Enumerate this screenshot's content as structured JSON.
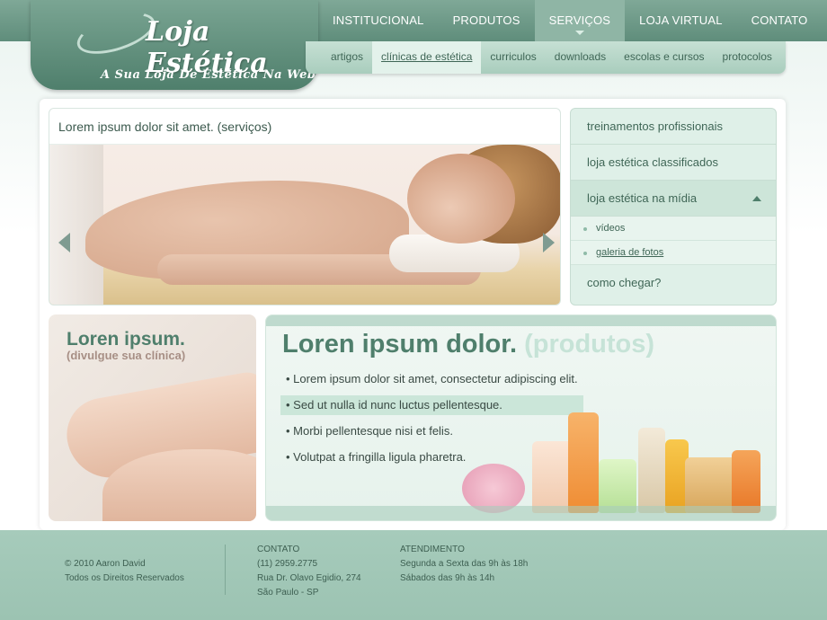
{
  "logo": {
    "title": "Loja Estética",
    "subtitle": "A Sua Loja De Estética Na Web"
  },
  "nav": {
    "items": [
      "INSTITUCIONAL",
      "PRODUTOS",
      "SERVIÇOS",
      "LOJA VIRTUAL",
      "CONTATO"
    ],
    "active": "SERVIÇOS"
  },
  "subnav": {
    "items": [
      "artigos",
      "clínicas de estética",
      "curriculos",
      "downloads",
      "escolas e cursos",
      "protocolos"
    ],
    "active": "clínicas de estética"
  },
  "hero": {
    "title": "Lorem ipsum dolor sit amet. (serviços)"
  },
  "sidebar": {
    "items": [
      {
        "label": "treinamentos profissionais"
      },
      {
        "label": "loja estética classificados"
      },
      {
        "label": "loja estética na mídia",
        "expanded": true,
        "children": [
          "vídeos",
          "galeria de fotos"
        ]
      },
      {
        "label": "como chegar?"
      }
    ]
  },
  "card": {
    "title": "Loren ipsum.",
    "subtitle": "(divulgue sua clínica)"
  },
  "promo": {
    "title": "Loren ipsum dolor.",
    "title_light": "(produtos)",
    "bullets": [
      "Lorem ipsum dolor sit amet, consectetur adipiscing elit.",
      "Sed ut nulla id nunc luctus pellentesque.",
      "Morbi pellentesque nisi et felis.",
      "Volutpat a fringilla ligula pharetra."
    ],
    "highlighted_index": 1
  },
  "footer": {
    "copyright": [
      "© 2010 Aaron David",
      "Todos os Direitos Reservados"
    ],
    "contato": {
      "heading": "CONTATO",
      "lines": [
        "(11) 2959.2775",
        "Rua Dr. Olavo Egidio, 274",
        "São Paulo - SP"
      ]
    },
    "atendimento": {
      "heading": "ATENDIMENTO",
      "lines": [
        "Segunda a Sexta das 9h às 18h",
        "Sábados das 9h às 14h"
      ]
    }
  },
  "colors": {
    "brand": "#5f8d7b",
    "accent_light": "#dff0e8",
    "footer": "#a6cbbb"
  }
}
